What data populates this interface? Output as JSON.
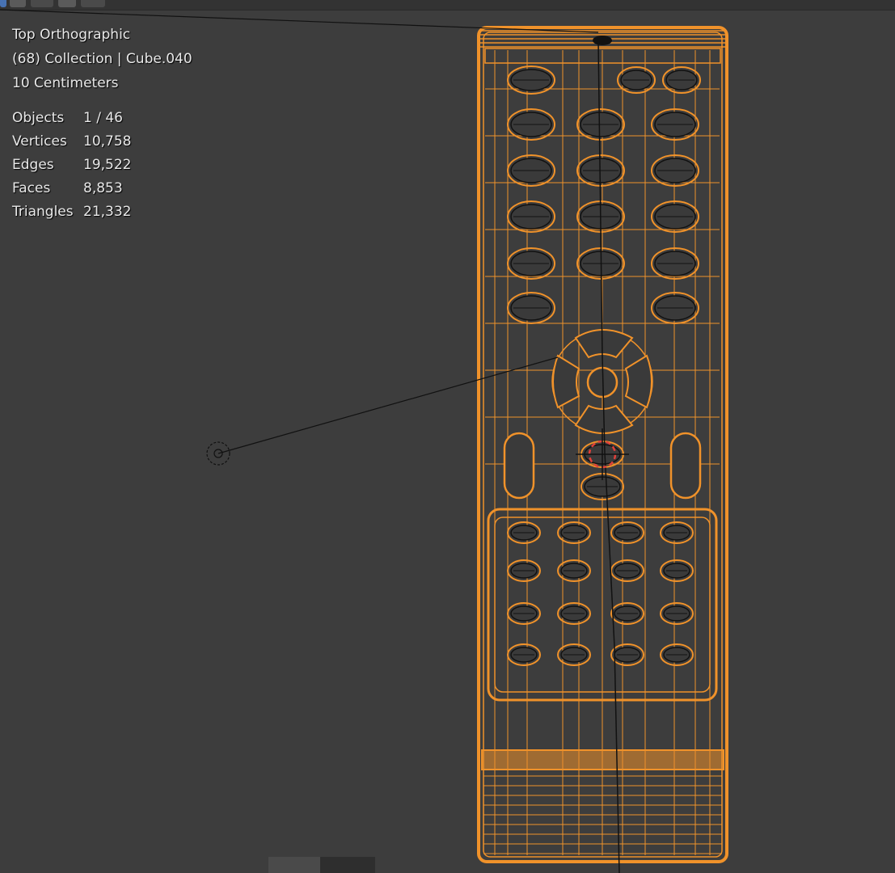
{
  "viewport": {
    "view_name": "Top Orthographic",
    "collection_line": "(68) Collection | Cube.040",
    "scale_label": "10 Centimeters"
  },
  "statistics": [
    {
      "label": "Objects",
      "value": "1 / 46"
    },
    {
      "label": "Vertices",
      "value": "10,758"
    },
    {
      "label": "Edges",
      "value": "19,522"
    },
    {
      "label": "Faces",
      "value": "8,853"
    },
    {
      "label": "Triangles",
      "value": "21,332"
    }
  ],
  "colors": {
    "background": "#3d3d3d",
    "wire_selected": "#f0922a",
    "wire_dark": "#111111",
    "cursor_red": "#e0403a"
  },
  "icons": [
    "select-mode-icon",
    "light-object-icon",
    "3d-cursor-icon"
  ]
}
